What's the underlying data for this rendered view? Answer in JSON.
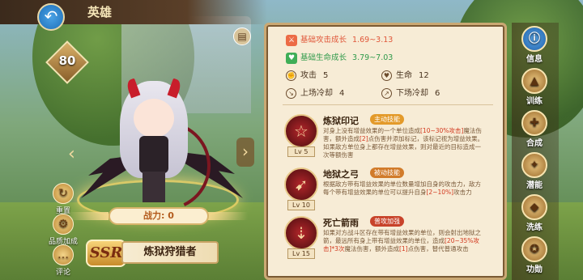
{
  "header": {
    "title": "英雄"
  },
  "level": "80",
  "left_buttons": {
    "reset": "重置",
    "gear": "品质加成",
    "comment": "评论"
  },
  "hero": {
    "power_label": "战力: 0",
    "rarity": "SSR",
    "name": "炼狱狩猎者"
  },
  "growth": {
    "attack": {
      "label": "基础攻击成长",
      "value": "1.69~3.13"
    },
    "hp": {
      "label": "基础生命成长",
      "value": "3.79~7.03"
    }
  },
  "stats": {
    "attack": {
      "label": "攻击",
      "value": "5"
    },
    "life": {
      "label": "生命",
      "value": "12"
    },
    "enter_cd": {
      "label": "上场冷却",
      "value": "4"
    },
    "leave_cd": {
      "label": "下场冷却",
      "value": "6"
    }
  },
  "skills": [
    {
      "name": "炼狱印记",
      "tag": "主动技能",
      "lv": "Lv 5",
      "desc_a": "对身上没有增益效果的一个单位造成",
      "desc_hl1": "[10~30%攻击]",
      "desc_b": "魔法伤害，额外造成",
      "desc_hl2": "[2]",
      "desc_c": "点伤害并添加标记，该标记视为增益效果。如果敌方单位身上都存在增益效果，则对最近的目标造成一次等额伤害"
    },
    {
      "name": "地狱之弓",
      "tag": "被动技能",
      "lv": "Lv 10",
      "desc_a": "根据敌方带有增益效果的单位数量增加自身的攻击力，敌方每个带有增益效果的单位可以提升自身",
      "desc_hl1": "[2~10%]",
      "desc_b": "攻击力"
    },
    {
      "name": "死亡箭雨",
      "tag": "普攻加强",
      "lv": "Lv 15",
      "desc_a": "如果对方战斗区存在带有增益效果的单位，则会射出地狱之箭，最远所有身上带有增益效果的单位，造成",
      "desc_hl1": "[20~35%攻击]*3次",
      "desc_b": "魔法伤害，额外造成",
      "desc_hl2": "[1]",
      "desc_c": "点伤害，替代普通攻击"
    }
  ],
  "nav": [
    "信息",
    "训练",
    "合成",
    "潜能",
    "洗练",
    "功勋"
  ]
}
